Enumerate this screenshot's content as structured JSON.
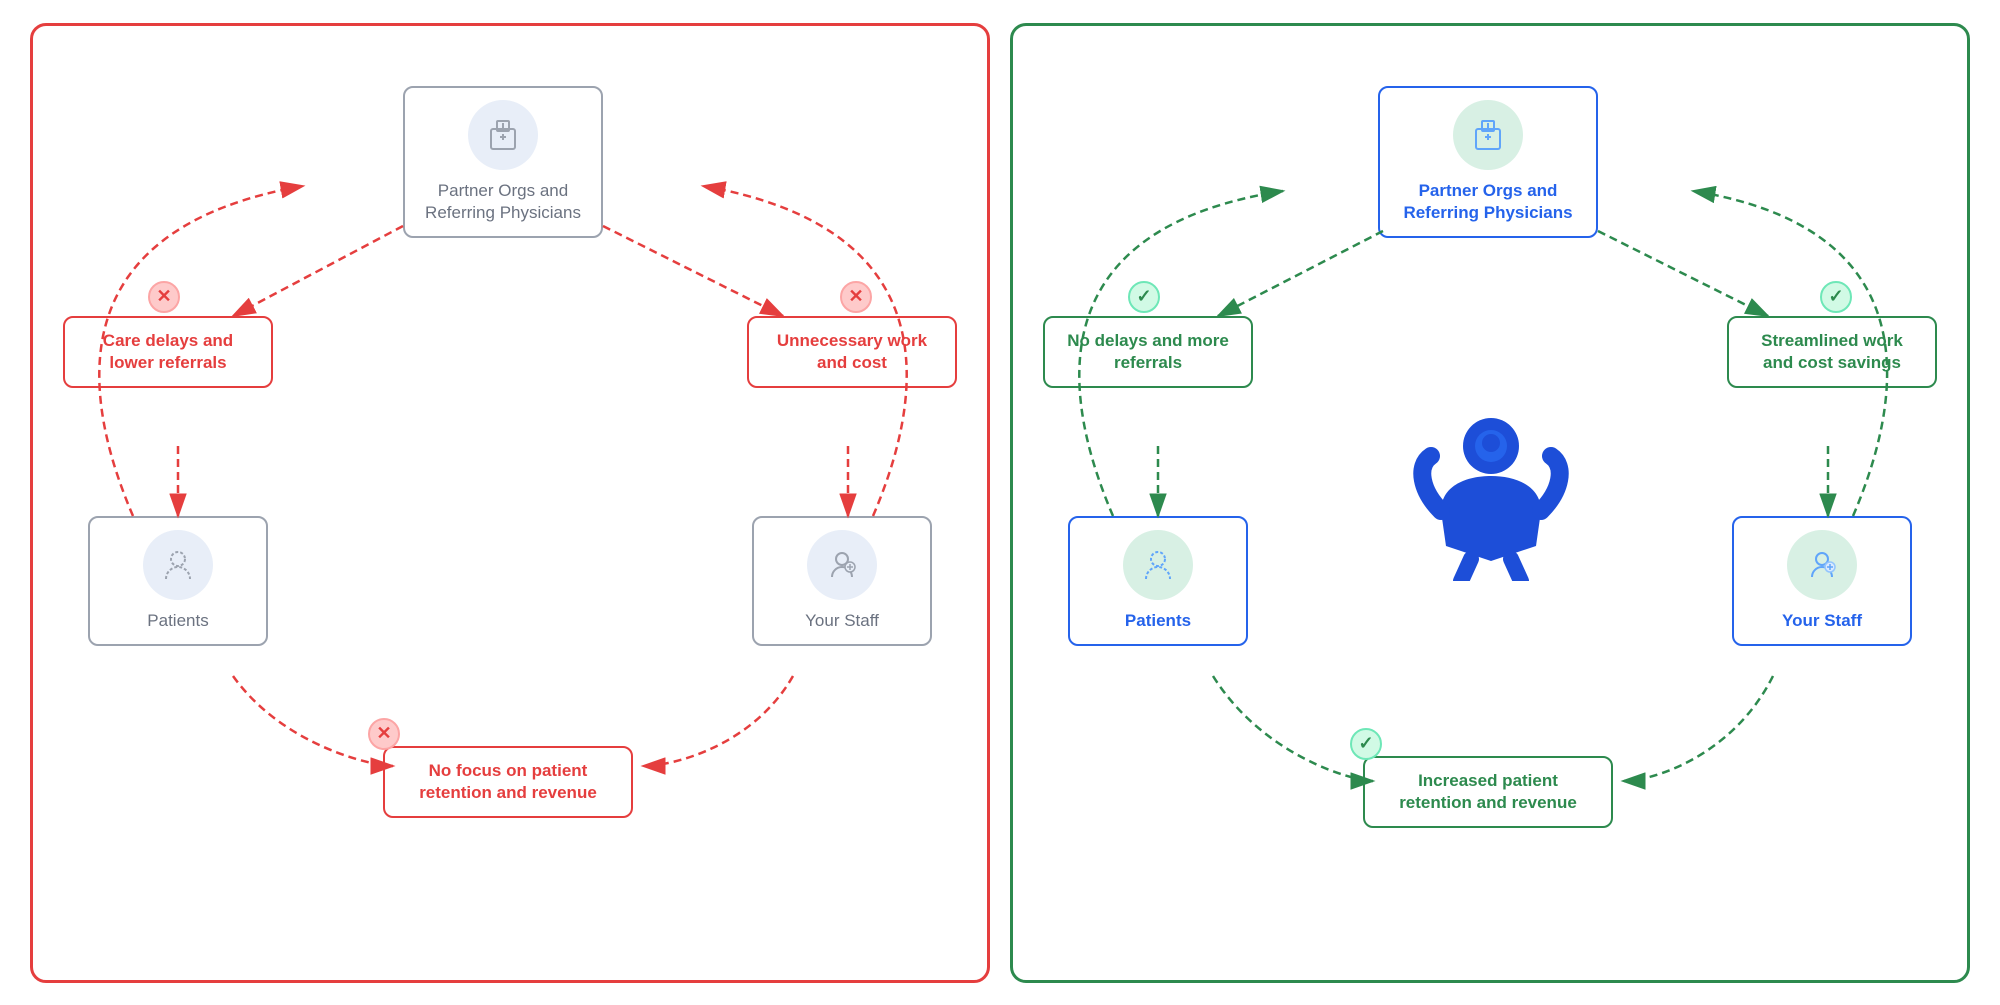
{
  "left_panel": {
    "border_color": "#e53e3e",
    "partner_box": {
      "label": "Partner Orgs\nand Referring\nPhysicians"
    },
    "care_box": {
      "label": "Care delays and\nlower referrals"
    },
    "unnecessary_box": {
      "label": "Unnecessary\nwork and cost"
    },
    "patients_box": {
      "label": "Patients"
    },
    "staff_box": {
      "label": "Your Staff"
    },
    "no_focus_box": {
      "label": "No focus on patient\nretention and revenue"
    }
  },
  "right_panel": {
    "border_color": "#2d8a4e",
    "partner_box": {
      "label": "Partner Orgs\nand Referring\nPhysicians"
    },
    "no_delays_box": {
      "label": "No delays and\nmore referrals"
    },
    "streamlined_box": {
      "label": "Streamlined work\nand cost savings"
    },
    "patients_box": {
      "label": "Patients"
    },
    "staff_box": {
      "label": "Your Staff"
    },
    "increased_box": {
      "label": "Increased patient\nretention and revenue"
    }
  }
}
